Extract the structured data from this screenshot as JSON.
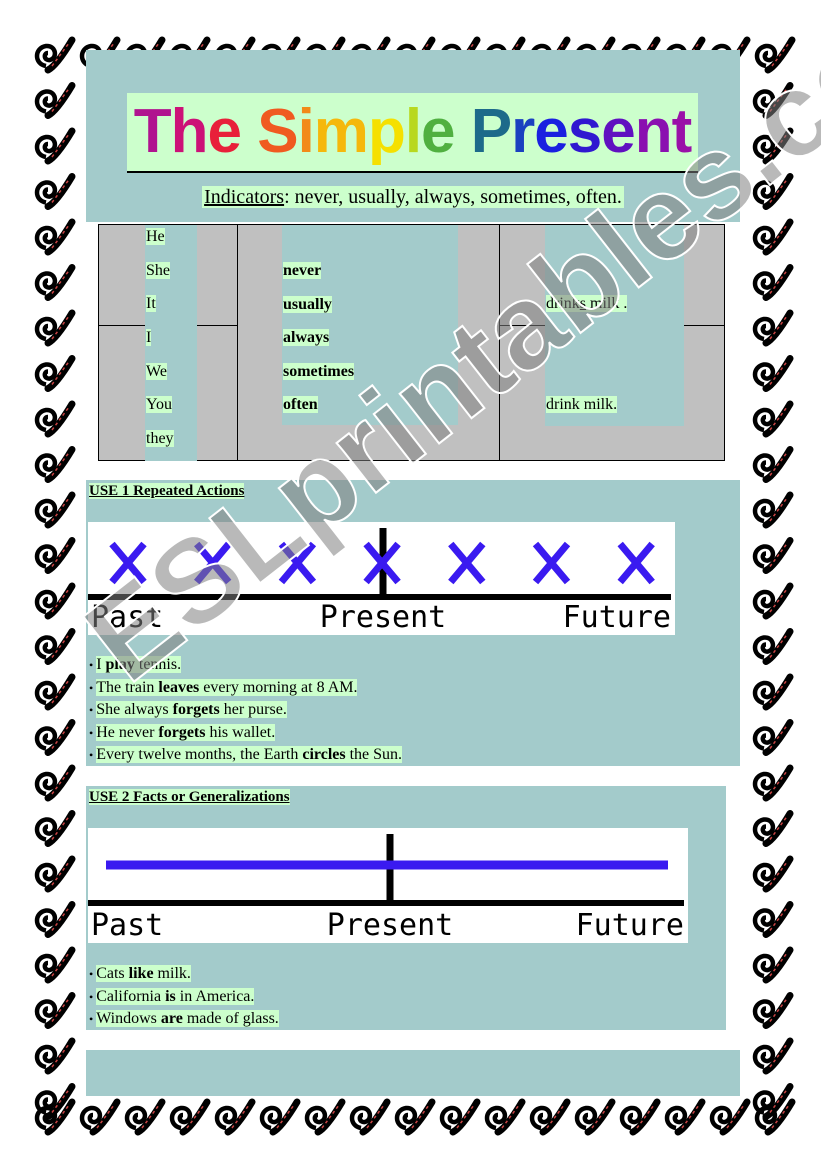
{
  "title": "The Simple Present",
  "title_colors": [
    "#b0138f",
    "#cc1177",
    "#e8203a",
    "#e83a2a",
    "#f05a20",
    "#f28a18",
    "#f5b80c",
    "#f5e000",
    "#b8d820",
    "#50b040",
    "#209060",
    "#1d6a8a",
    "#1a40c0",
    "#1a20e0",
    "#3018d0",
    "#6010c0",
    "#8a10b0",
    "#9a10a8"
  ],
  "indicators": {
    "label": "Indicators",
    "text": ": never, usually, always, sometimes, often."
  },
  "table": {
    "group1_subjects": [
      "He",
      "She",
      "It"
    ],
    "group2_subjects": [
      "I",
      "We",
      "You",
      "they"
    ],
    "adverbs": [
      "never",
      "usually",
      "always",
      "sometimes",
      "often"
    ],
    "verb1": {
      "pre": "drink",
      "ending": "s",
      "post": " milk ."
    },
    "verb2": "drink milk."
  },
  "use1": {
    "heading": "USE 1 Repeated Actions",
    "timeline": {
      "past": "Past",
      "present": "Present",
      "future": "Future",
      "mark_color": "#3a1af0",
      "marks": 7
    },
    "examples": [
      [
        [
          "I ",
          0
        ],
        [
          "play",
          1
        ],
        [
          " tennis.",
          0
        ]
      ],
      [
        [
          "The train ",
          0
        ],
        [
          "leaves",
          1
        ],
        [
          " every morning at 8 AM.",
          0
        ]
      ],
      [
        [
          "She always ",
          0
        ],
        [
          "forgets",
          1
        ],
        [
          " her purse.",
          0
        ]
      ],
      [
        [
          "He never ",
          0
        ],
        [
          "forgets",
          1
        ],
        [
          " his wallet.",
          0
        ]
      ],
      [
        [
          "Every twelve months, the Earth ",
          0
        ],
        [
          "circles",
          1
        ],
        [
          " the Sun.",
          0
        ]
      ]
    ]
  },
  "use2": {
    "heading": "USE 2 Facts or Generalizations",
    "timeline": {
      "past": "Past",
      "present": "Present",
      "future": "Future",
      "line_color": "#3a1af0"
    },
    "examples": [
      [
        [
          "Cats ",
          0
        ],
        [
          "like",
          1
        ],
        [
          " milk.",
          0
        ]
      ],
      [
        [
          "California ",
          0
        ],
        [
          "is",
          1
        ],
        [
          " in America.",
          0
        ]
      ],
      [
        [
          "Windows ",
          0
        ],
        [
          "are",
          1
        ],
        [
          " made of glass.",
          0
        ]
      ]
    ]
  },
  "watermark": "ESLprintables.com",
  "colors": {
    "panel": "#a3cbcb",
    "highlight": "#ccffcc",
    "table_bg": "#c0c0c0"
  }
}
